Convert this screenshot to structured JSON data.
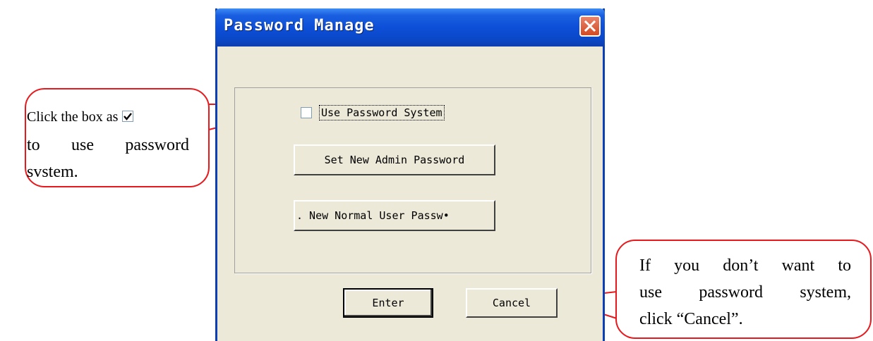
{
  "dialog": {
    "title": "Password Manage",
    "checkbox_label": "Use Password System",
    "checkbox_checked": false,
    "set_admin_button": "Set New Admin Password",
    "set_normal_button": ". New Normal User Passw•",
    "enter_button": "Enter",
    "cancel_button": "Cancel"
  },
  "callouts": {
    "left": {
      "line1": "Click the box as",
      "line2": "to use password",
      "line3": "svstem."
    },
    "right": {
      "line1": "If you don’t want to",
      "line2": "use password system,",
      "line3": "click “Cancel”."
    }
  },
  "colors": {
    "accent": "#e8191d",
    "titlebar": "#0d4fd8",
    "window_bg": "#ece9d8"
  },
  "icons": {
    "close": "close-icon",
    "check": "check-icon"
  }
}
